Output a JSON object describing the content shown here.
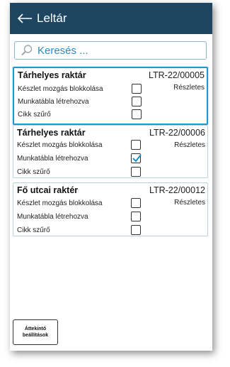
{
  "header": {
    "title": "Leltár",
    "back_icon": "back-arrow-icon"
  },
  "search": {
    "placeholder": "Keresés ...",
    "icon": "search-icon"
  },
  "cards": [
    {
      "title": "Tárhelyes raktár",
      "code": "LTR-22/00005",
      "details_label": "Részletes",
      "selected": true,
      "rows": [
        {
          "label": "Készlet mozgás blokkolása",
          "checked": false
        },
        {
          "label": "Munkatábla létrehozva",
          "checked": false
        },
        {
          "label": "Cikk szűrő",
          "checked": false
        }
      ]
    },
    {
      "title": "Tárhelyes raktár",
      "code": "LTR-22/00006",
      "details_label": "Részletes",
      "selected": false,
      "rows": [
        {
          "label": "Készlet mozgás blokkolása",
          "checked": false
        },
        {
          "label": "Munkatábla létrehozva",
          "checked": true
        },
        {
          "label": "Cikk szűrő",
          "checked": false
        }
      ]
    },
    {
      "title": "Fő utcai raktér",
      "code": "LTR-22/00012",
      "details_label": "Részletes",
      "selected": false,
      "rows": [
        {
          "label": "Készlet mozgás blokkolása",
          "checked": false
        },
        {
          "label": "Munkatábla létrehozva",
          "checked": false
        },
        {
          "label": "Cikk szűrő",
          "checked": false
        }
      ]
    }
  ],
  "footer": {
    "overview_button_line1": "Áttekintő",
    "overview_button_line2": "beállítások"
  },
  "colors": {
    "header_bg": "#1f4661",
    "accent": "#1a9ad6",
    "search_text": "#2a8cc4",
    "check": "#1a8fd0"
  }
}
